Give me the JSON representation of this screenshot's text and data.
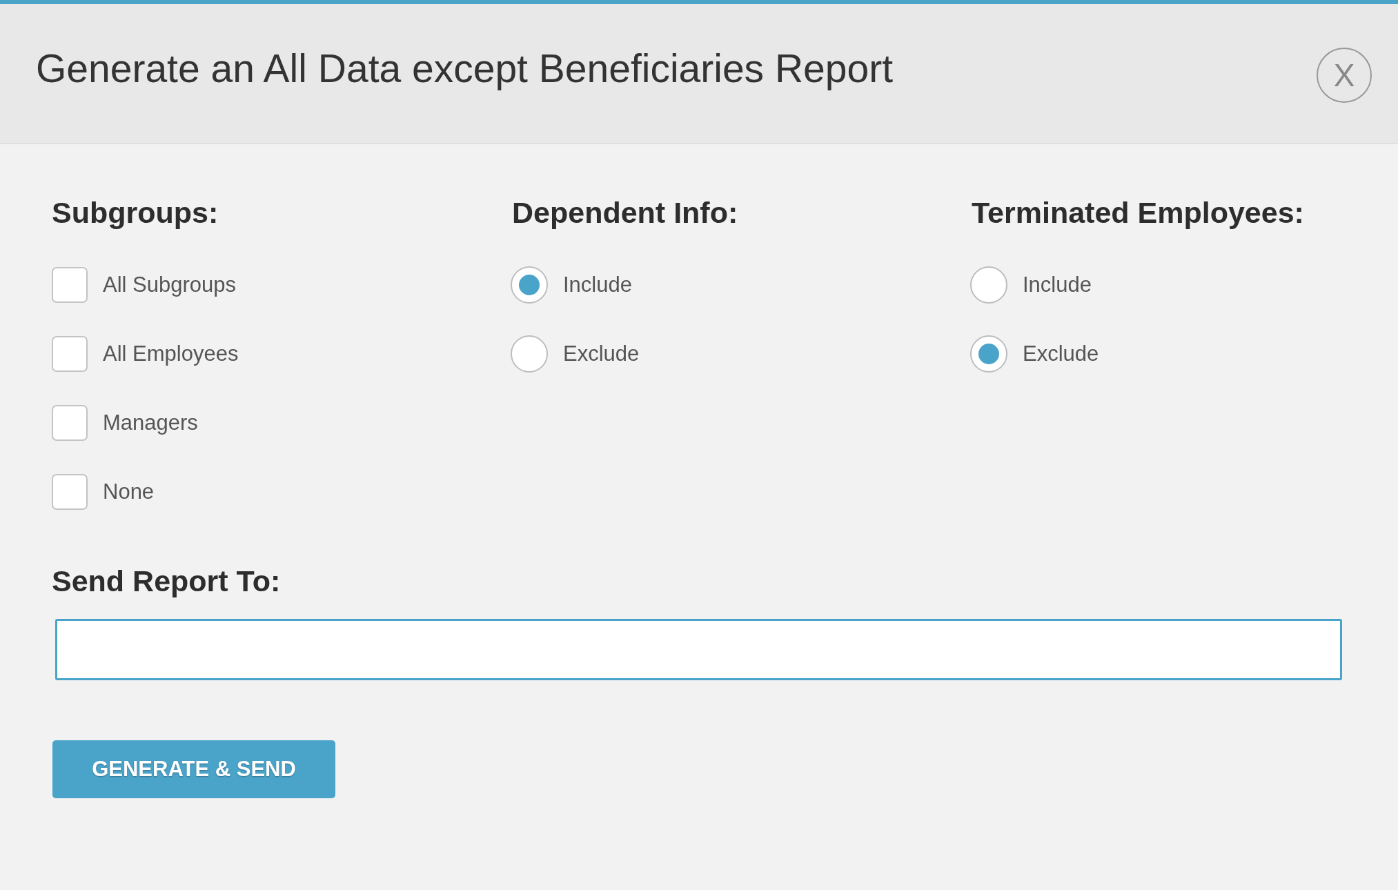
{
  "dialog": {
    "title": "Generate an All Data except Beneficiaries Report",
    "close": "X"
  },
  "groups": [
    {
      "kind": "checkbox",
      "heading": "Subgroups:",
      "options": [
        {
          "label": "All Subgroups",
          "checked": false
        },
        {
          "label": "All Employees",
          "checked": false
        },
        {
          "label": "Managers",
          "checked": false
        },
        {
          "label": "None",
          "checked": false
        }
      ]
    },
    {
      "kind": "radio",
      "heading": "Dependent Info:",
      "options": [
        {
          "label": "Include",
          "selected": true
        },
        {
          "label": "Exclude",
          "selected": false
        }
      ]
    },
    {
      "kind": "radio",
      "heading": "Terminated Employees:",
      "options": [
        {
          "label": "Include",
          "selected": false
        },
        {
          "label": "Exclude",
          "selected": true
        }
      ]
    }
  ],
  "send_to": {
    "label": "Send Report To:",
    "focused": true
  },
  "buttons": [
    "GENERATE & SEND"
  ]
}
